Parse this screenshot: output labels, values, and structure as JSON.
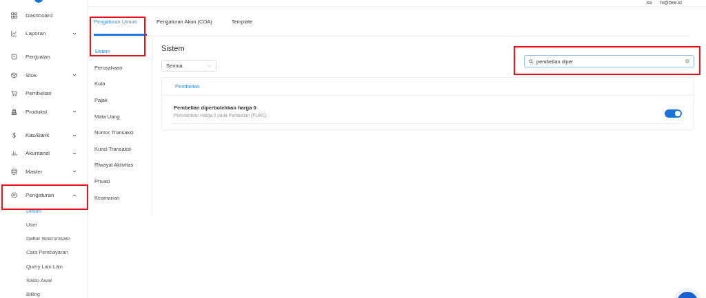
{
  "header": {
    "user": "sa",
    "email": "hi@bee.id"
  },
  "sidebar": {
    "groups": [
      [
        {
          "label": "Dashboard",
          "kind": "grid",
          "expandable": false,
          "highlighted": false
        },
        {
          "label": "Laporan",
          "kind": "chart",
          "expandable": true,
          "expanded": false,
          "highlighted": false
        }
      ],
      [
        {
          "label": "Penjualan",
          "kind": "sale",
          "expandable": false,
          "highlighted": false
        },
        {
          "label": "Stok",
          "kind": "box",
          "expandable": true,
          "expanded": false,
          "highlighted": false
        },
        {
          "label": "Pembelian",
          "kind": "cart",
          "expandable": false,
          "highlighted": false
        },
        {
          "label": "Produksi",
          "kind": "factory",
          "expandable": true,
          "expanded": false,
          "highlighted": false
        }
      ],
      [
        {
          "label": "Kas/Bank",
          "kind": "dollar",
          "expandable": true,
          "expanded": false,
          "highlighted": false
        },
        {
          "label": "Akuntansi",
          "kind": "bars",
          "expandable": true,
          "expanded": false,
          "highlighted": false
        },
        {
          "label": "Master",
          "kind": "database",
          "expandable": true,
          "expanded": false,
          "highlighted": false
        }
      ],
      [
        {
          "label": "Pengaturan",
          "kind": "gear",
          "expandable": true,
          "expanded": true,
          "highlighted": true,
          "children": [
            {
              "label": "Umum",
              "selected": true
            },
            {
              "label": "User",
              "selected": false
            },
            {
              "label": "Daftar Sinkronisasi",
              "selected": false
            },
            {
              "label": "Cara Pembayaran",
              "selected": false
            },
            {
              "label": "Query Lain Lain",
              "selected": false
            },
            {
              "label": "Saldo Awal",
              "selected": false
            },
            {
              "label": "Billing",
              "selected": false
            }
          ]
        }
      ]
    ]
  },
  "tabs": [
    {
      "label": "Pengaturan Umum",
      "selected": true,
      "highlighted": true
    },
    {
      "label": "Pengaturan Akun (COA)",
      "selected": false,
      "highlighted": false
    },
    {
      "label": "Template",
      "selected": false,
      "highlighted": false
    }
  ],
  "settings_menu": [
    {
      "label": "Sistem",
      "selected": true
    },
    {
      "label": "Perusahaan",
      "selected": false
    },
    {
      "label": "Kota",
      "selected": false
    },
    {
      "label": "Pajak",
      "selected": false
    },
    {
      "label": "Mata Uang",
      "selected": false
    },
    {
      "label": "Nomor Transaksi",
      "selected": false
    },
    {
      "label": "Kunci Transaksi",
      "selected": false
    },
    {
      "label": "Riwayat Aktivitas",
      "selected": false
    },
    {
      "label": "Privasi",
      "selected": false
    },
    {
      "label": "Keamanan",
      "selected": false
    }
  ],
  "content": {
    "title": "Sistem",
    "filter": {
      "value": "Semua"
    },
    "search": {
      "value": "pembelian diper",
      "highlighted": true
    },
    "section_tabs": [
      {
        "label": "Pembelian",
        "selected": true
      }
    ],
    "settings": [
      {
        "title": "Pembelian diperbolehkan harga 0",
        "description": "Perbolehkan Harga 0 pada Pembelian (PURC)",
        "on": true
      }
    ]
  }
}
